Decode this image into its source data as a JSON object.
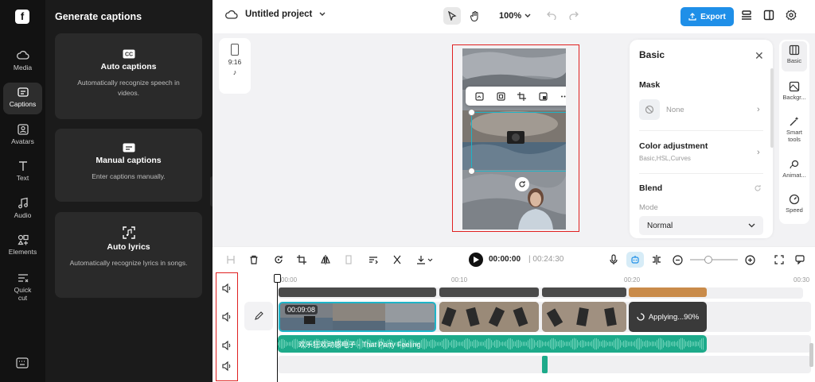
{
  "rail": {
    "items": [
      {
        "label": "Media",
        "icon": "cloud-icon"
      },
      {
        "label": "Captions",
        "icon": "captions-icon"
      },
      {
        "label": "Avatars",
        "icon": "avatar-icon"
      },
      {
        "label": "Text",
        "icon": "text-icon"
      },
      {
        "label": "Audio",
        "icon": "music-icon"
      },
      {
        "label": "Elements",
        "icon": "elements-icon"
      },
      {
        "label": "Quick cut",
        "icon": "quick-cut-icon"
      }
    ],
    "active": "Captions"
  },
  "panel": {
    "title": "Generate captions",
    "cards": [
      {
        "title": "Auto captions",
        "desc": "Automatically recognize speech in videos.",
        "icon": "cc-icon"
      },
      {
        "title": "Manual captions",
        "desc": "Enter captions manually.",
        "icon": "keyboard-icon"
      },
      {
        "title": "Auto lyrics",
        "desc": "Automatically recognize lyrics in songs.",
        "icon": "lyrics-scan-icon"
      }
    ]
  },
  "topbar": {
    "project_name": "Untitled project",
    "zoom": "100%",
    "export_label": "Export"
  },
  "canvas": {
    "ratio": "9:16",
    "platform_icon": "tiktok-icon"
  },
  "props": {
    "title": "Basic",
    "mask_title": "Mask",
    "mask_value": "None",
    "color_title": "Color adjustment",
    "color_sub": "Basic,HSL,Curves",
    "blend_title": "Blend",
    "mode_label": "Mode",
    "mode_value": "Normal"
  },
  "right_rail": {
    "items": [
      {
        "label": "Basic",
        "icon": "basic-icon"
      },
      {
        "label": "Backgr...",
        "icon": "background-icon"
      },
      {
        "label": "Smart tools",
        "icon": "magic-wand-icon"
      },
      {
        "label": "Animat...",
        "icon": "animation-icon"
      },
      {
        "label": "Speed",
        "icon": "speed-icon"
      }
    ],
    "active": "Basic"
  },
  "timeline": {
    "current_time": "00:00:00",
    "total_time": "00:24:30",
    "ruler": [
      "00:00",
      "00:10",
      "00:20",
      "00:30"
    ],
    "clip_duration": "00:09:08",
    "applying_text": "Applying...90%",
    "audio_label": "欢乐狂欢动感电子 - That Party Feeling"
  },
  "colors": {
    "accent": "#1f8fe8",
    "selection": "#1db4c8",
    "audio": "#1daa8a",
    "highlight": "#e02020"
  }
}
